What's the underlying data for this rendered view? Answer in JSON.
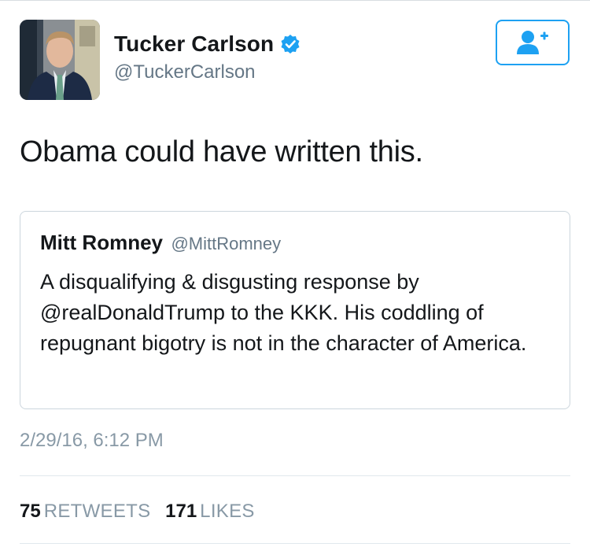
{
  "author": {
    "display_name": "Tucker Carlson",
    "handle": "@TuckerCarlson"
  },
  "tweet": {
    "text": "Obama could have written this.",
    "timestamp": "2/29/16, 6:12 PM"
  },
  "quoted_tweet": {
    "display_name": "Mitt Romney",
    "handle": "@MittRomney",
    "text": "A disqualifying & disgusting response by @realDonaldTrump to the KKK. His coddling of repugnant bigotry is not in the character of America."
  },
  "stats": {
    "retweets_count": "75",
    "retweets_label": "RETWEETS",
    "likes_count": "171",
    "likes_label": "LIKES"
  },
  "icons": {
    "verified": "verified-badge-icon",
    "follow": "follow-user-plus-icon"
  },
  "colors": {
    "accent": "#1da1f2",
    "text_primary": "#14171a",
    "text_secondary": "#657786",
    "text_muted": "#8899a6"
  }
}
